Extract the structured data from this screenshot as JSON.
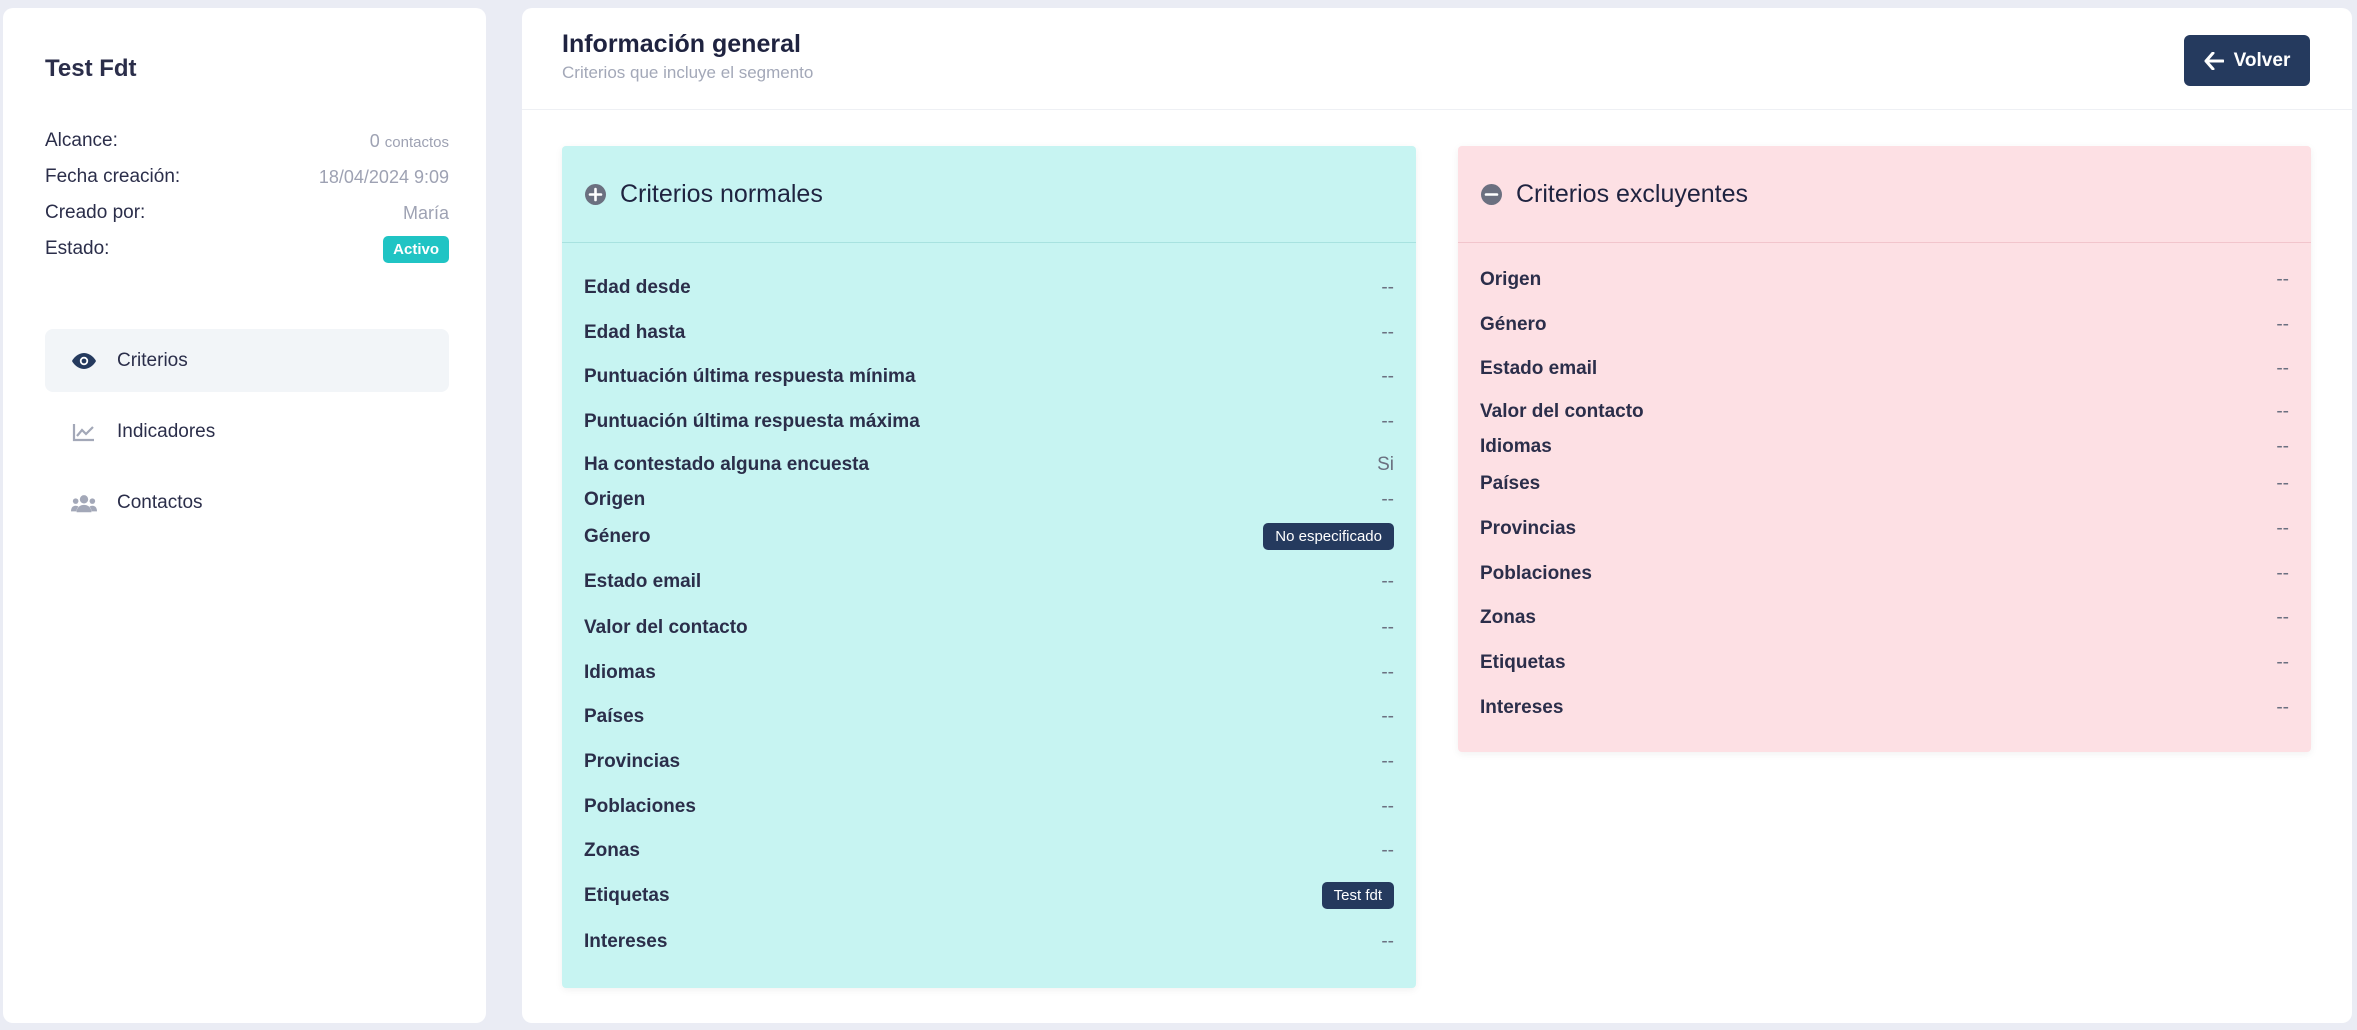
{
  "segment": {
    "title": "Test Fdt",
    "info": [
      {
        "label": "Alcance:",
        "value": "0",
        "unit": "contactos"
      },
      {
        "label": "Fecha creación:",
        "value": "18/04/2024 9:09"
      },
      {
        "label": "Creado por:",
        "value": "María"
      },
      {
        "label": "Estado:",
        "badge": "Activo"
      }
    ]
  },
  "nav": {
    "items": [
      {
        "label": "Criterios",
        "icon": "eye-icon",
        "active": true
      },
      {
        "label": "Indicadores",
        "icon": "chart-line-icon"
      },
      {
        "label": "Contactos",
        "icon": "users-icon"
      }
    ]
  },
  "header": {
    "title": "Información general",
    "subtitle": "Criterios que incluye el segmento",
    "back_label": "Volver"
  },
  "normal": {
    "title": "Criterios normales",
    "rows": [
      {
        "label": "Edad desde",
        "value": "--"
      },
      {
        "label": "Edad hasta",
        "value": "--"
      },
      {
        "label": "Puntuación última respuesta mínima",
        "value": "--"
      },
      {
        "label": "Puntuación última respuesta máxima",
        "value": "--"
      },
      {
        "label": "Ha contestado alguna encuesta",
        "value": "Si"
      },
      {
        "label": "Origen",
        "value": "--"
      },
      {
        "label": "Género",
        "badge": "No especificado"
      },
      {
        "label": "Estado email",
        "value": "--"
      },
      {
        "label": "Valor del contacto",
        "value": "--"
      },
      {
        "label": "Idiomas",
        "value": "--"
      },
      {
        "label": "Países",
        "value": "--"
      },
      {
        "label": "Provincias",
        "value": "--"
      },
      {
        "label": "Poblaciones",
        "value": "--"
      },
      {
        "label": "Zonas",
        "value": "--"
      },
      {
        "label": "Etiquetas",
        "badge": "Test fdt"
      },
      {
        "label": "Intereses",
        "value": "--"
      }
    ]
  },
  "excl": {
    "title": "Criterios excluyentes",
    "rows": [
      {
        "label": "Origen",
        "value": "--"
      },
      {
        "label": "Género",
        "value": "--"
      },
      {
        "label": "Estado email",
        "value": "--"
      },
      {
        "label": "Valor del contacto",
        "value": "--"
      },
      {
        "label": "Idiomas",
        "value": "--"
      },
      {
        "label": "Países",
        "value": "--"
      },
      {
        "label": "Provincias",
        "value": "--"
      },
      {
        "label": "Poblaciones",
        "value": "--"
      },
      {
        "label": "Zonas",
        "value": "--"
      },
      {
        "label": "Etiquetas",
        "value": "--"
      },
      {
        "label": "Intereses",
        "value": "--"
      }
    ]
  },
  "colors": {
    "primary": "#253a5e",
    "active_badge": "#20c4c4",
    "normal_bg": "#c7f4f2",
    "excl_bg": "#fde0e4"
  }
}
